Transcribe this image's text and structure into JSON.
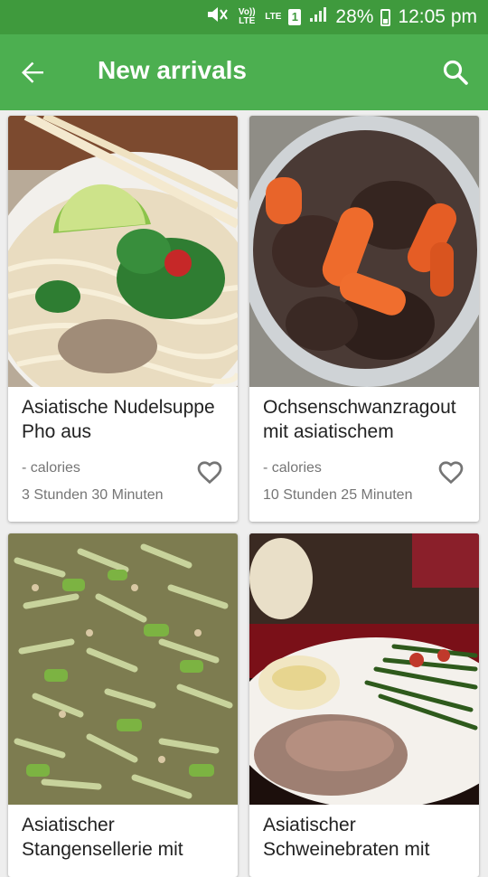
{
  "status_bar": {
    "volte_label": "Vo)) LTE",
    "lte_label": "LTE",
    "sim_number": "1",
    "battery": "28%",
    "time": "12:05 pm"
  },
  "app_bar": {
    "title": "New arrivals",
    "back_icon": "arrow-back-icon",
    "search_icon": "search-icon"
  },
  "colors": {
    "status_bar": "#3f9a3d",
    "app_bar": "#4caf50",
    "background": "#eeeeee"
  },
  "recipes": [
    {
      "title": "Asiatische Nudelsuppe Pho aus",
      "calories": "- calories",
      "duration": "3 Stunden 30 Minuten",
      "favorite_icon": "heart-outline-icon"
    },
    {
      "title": "Ochsenschwanzragout mit asiatischem",
      "calories": "- calories",
      "duration": "10 Stunden 25 Minuten",
      "favorite_icon": "heart-outline-icon"
    },
    {
      "title": "Asiatischer Stangensellerie mit",
      "calories": "",
      "duration": "",
      "favorite_icon": "heart-outline-icon"
    },
    {
      "title": "Asiatischer Schweinebraten mit",
      "calories": "",
      "duration": "",
      "favorite_icon": "heart-outline-icon"
    }
  ]
}
